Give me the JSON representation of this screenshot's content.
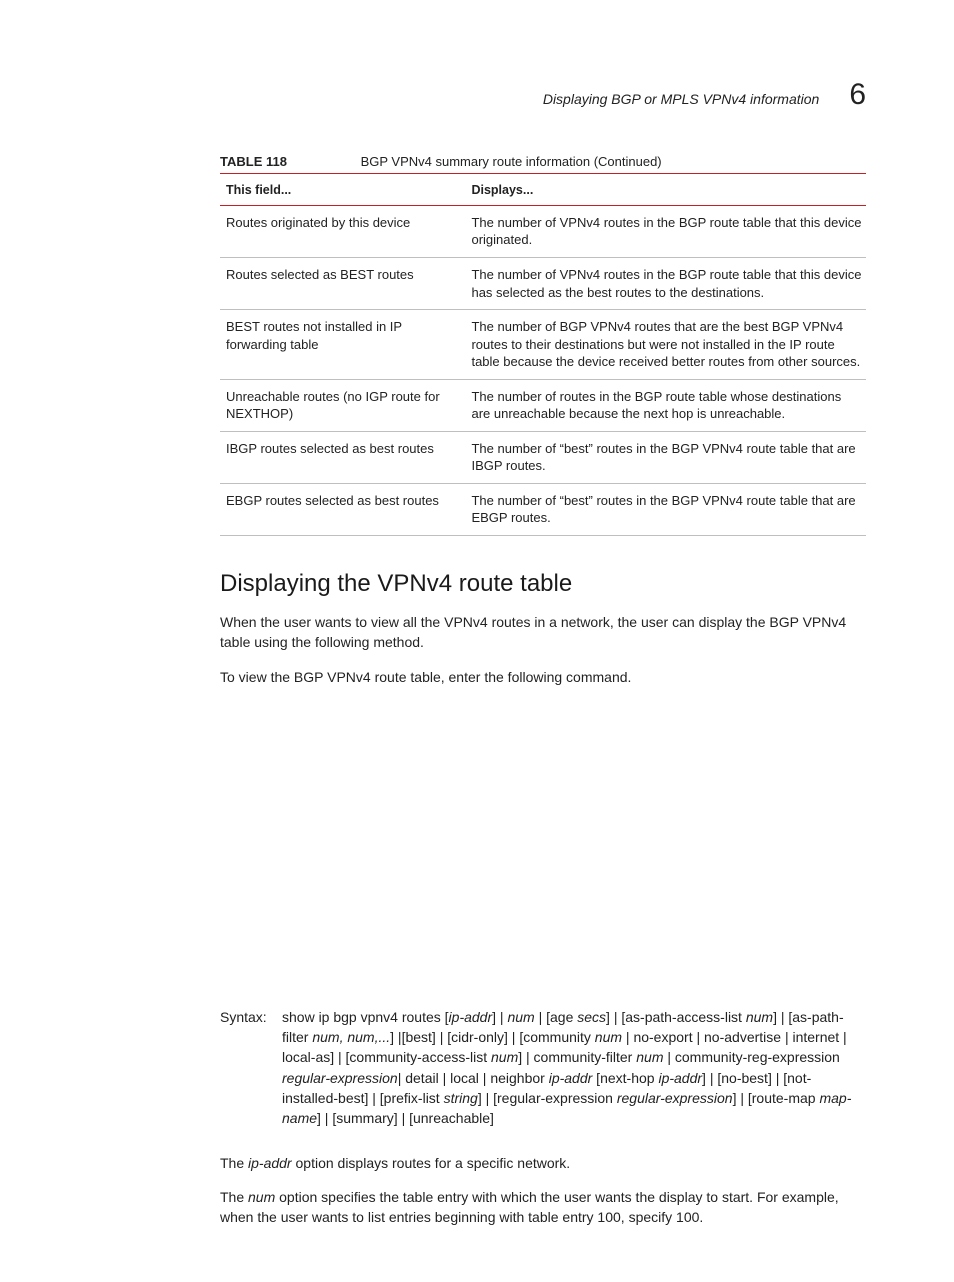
{
  "header": {
    "running_title": "Displaying BGP or MPLS VPNv4 information",
    "chapter_number": "6"
  },
  "table": {
    "caption_label": "TABLE 118",
    "caption_text": "BGP VPNv4 summary route information  (Continued)",
    "columns": [
      "This field...",
      "Displays..."
    ],
    "rows": [
      {
        "field": "Routes originated by this device",
        "displays": "The number of VPNv4 routes in the BGP route table that this device originated."
      },
      {
        "field": "Routes selected as BEST routes",
        "displays": "The number of VPNv4 routes in the BGP route table that this device has selected as the best routes to the destinations."
      },
      {
        "field": "BEST routes not installed in IP forwarding table",
        "displays": "The number of BGP VPNv4 routes that are the best BGP VPNv4 routes to their destinations but were not installed in the IP route table because the device received better routes from other sources."
      },
      {
        "field": "Unreachable routes (no IGP route for NEXTHOP)",
        "displays": "The number of routes in the BGP route table whose destinations are unreachable because the next hop is unreachable."
      },
      {
        "field": "IBGP routes selected as best routes",
        "displays": "The number of “best” routes in the BGP VPNv4 route table that are IBGP routes."
      },
      {
        "field": "EBGP routes selected as best routes",
        "displays": "The number of “best” routes in the BGP VPNv4 route table that are EBGP routes."
      }
    ]
  },
  "section": {
    "heading": "Displaying the VPNv4 route table",
    "para1": "When the user wants to view all the VPNv4 routes in a network, the user can display the BGP VPNv4 table using the following method.",
    "para2": "To view the BGP VPNv4 route table, enter the following command."
  },
  "syntax": {
    "label": "Syntax:",
    "tokens": [
      {
        "t": "show ip bgp vpnv4 routes ["
      },
      {
        "t": "ip-addr",
        "i": true
      },
      {
        "t": "] | "
      },
      {
        "t": "num",
        "i": true
      },
      {
        "t": " | [age "
      },
      {
        "t": "secs",
        "i": true
      },
      {
        "t": "] | [as-path-access-list  "
      },
      {
        "t": "num",
        "i": true
      },
      {
        "t": "] | [as-path-filter "
      },
      {
        "t": "num, num,...",
        "i": true
      },
      {
        "t": "] |[best] | [cidr-only] | [community "
      },
      {
        "t": "num",
        "i": true
      },
      {
        "t": " | no-export | no-advertise | internet | local-as] | [community-access-list "
      },
      {
        "t": "num",
        "i": true
      },
      {
        "t": "] | community-filter "
      },
      {
        "t": "num",
        "i": true
      },
      {
        "t": " | community-reg-expression "
      },
      {
        "t": "regular-expression",
        "i": true
      },
      {
        "t": "| detail | local | neighbor "
      },
      {
        "t": "ip-addr",
        "i": true
      },
      {
        "t": " [next-hop "
      },
      {
        "t": "ip-addr",
        "i": true
      },
      {
        "t": "] | [no-best] | [not-installed-best] | [prefix-list "
      },
      {
        "t": "string",
        "i": true
      },
      {
        "t": "] | [regular-expression "
      },
      {
        "t": "regular-expression",
        "i": true
      },
      {
        "t": "] | [route-map "
      },
      {
        "t": "map-name",
        "i": true
      },
      {
        "t": "] | [summary] | [unreachable]"
      }
    ]
  },
  "tail": {
    "p1": {
      "pre": "The ",
      "ital": "ip-addr",
      "post": " option displays routes for a specific network."
    },
    "p2": {
      "pre": "The ",
      "ital": "num",
      "post": " option specifies the table entry with which the user wants the display to start. For example, when the user wants to list entries beginning with table entry 100, specify 100."
    }
  }
}
